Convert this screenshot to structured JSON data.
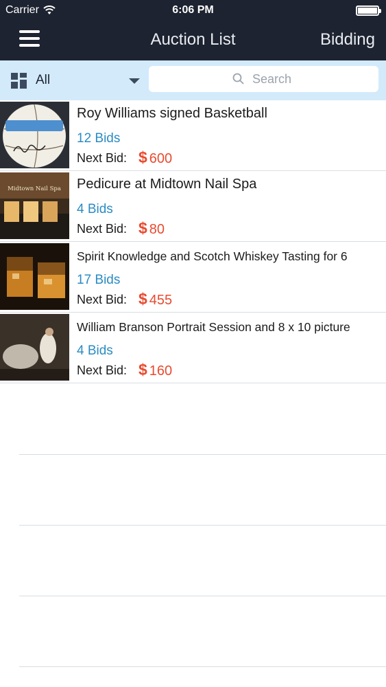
{
  "status": {
    "carrier": "Carrier",
    "time": "6:06 PM"
  },
  "nav": {
    "title": "Auction List",
    "right_label": "Bidding"
  },
  "filter": {
    "selected": "All"
  },
  "search": {
    "placeholder": "Search"
  },
  "colors": {
    "navbar": "#1d2330",
    "filterbar": "#d3eafb",
    "bids": "#2a8bc4",
    "price": "#e84b2f"
  },
  "items": [
    {
      "title": "Roy Williams signed Basketball",
      "bids": "12 Bids",
      "next_label": "Next Bid:",
      "currency": "$",
      "price": "600"
    },
    {
      "title": "Pedicure at Midtown Nail Spa",
      "bids": "4 Bids",
      "next_label": "Next Bid:",
      "currency": "$",
      "price": "80",
      "image_text": "Midtown Nail Spa"
    },
    {
      "title": "Spirit Knowledge and Scotch Whiskey Tasting for 6",
      "bids": "17 Bids",
      "next_label": "Next Bid:",
      "currency": "$",
      "price": "455"
    },
    {
      "title": "William Branson Portrait Session and 8 x 10 picture",
      "bids": "4 Bids",
      "next_label": "Next Bid:",
      "currency": "$",
      "price": "160"
    }
  ]
}
